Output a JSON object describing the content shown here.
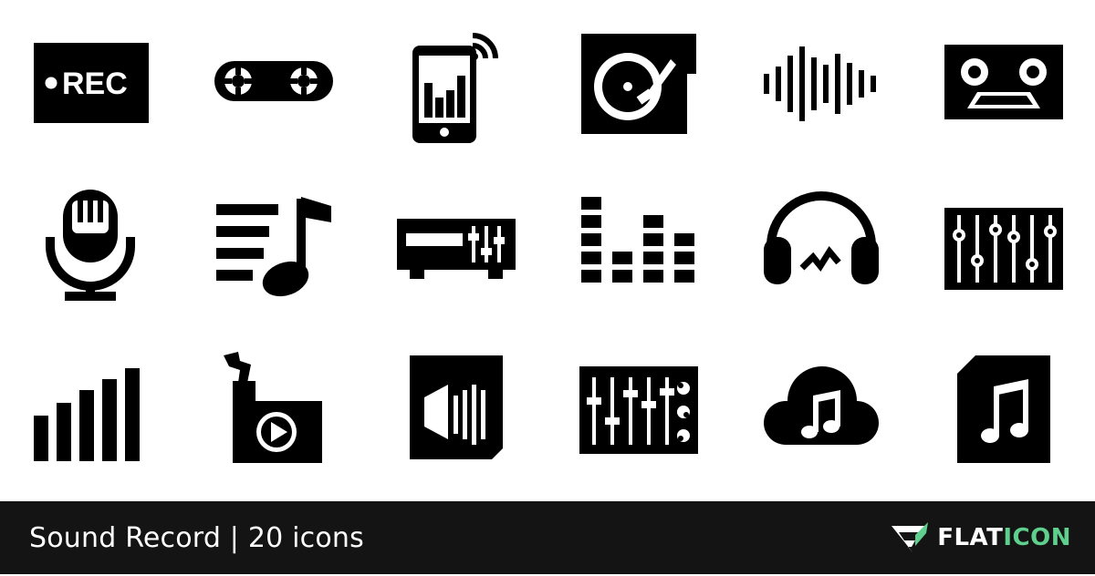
{
  "footer": {
    "title": "Sound Record | 20 icons",
    "brand_part1": "FLAT",
    "brand_part2": "ICON",
    "accent_color": "#5fcf8e",
    "background_color": "#141414"
  },
  "icons": {
    "rec_label": "●REC",
    "names": [
      "rec-icon",
      "tape-reel-icon",
      "phone-equalizer-icon",
      "turntable-icon",
      "sound-wave-icon",
      "cassette-icon",
      "microphone-icon",
      "playlist-icon",
      "radio-receiver-icon",
      "equalizer-bars-icon",
      "headphones-icon",
      "mixer-panel-icon",
      "signal-bars-icon",
      "portable-player-icon",
      "audio-file-icon",
      "mixing-console-icon",
      "cloud-music-icon",
      "music-file-icon"
    ]
  }
}
